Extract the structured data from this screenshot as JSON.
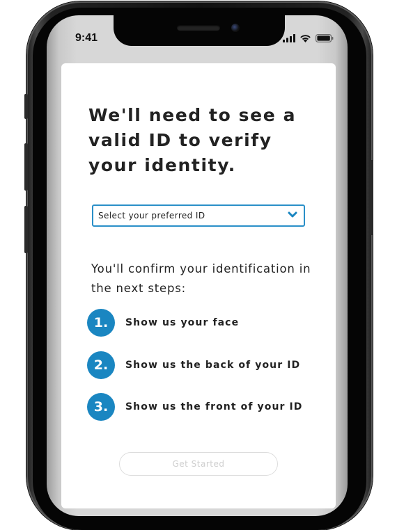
{
  "status_bar": {
    "time": "9:41",
    "icons": [
      "cellular-signal-icon",
      "wifi-icon",
      "battery-icon"
    ]
  },
  "card": {
    "title": "We'll need to see a valid ID to verify your identity.",
    "id_select": {
      "selected_text": "Select your preferred ID",
      "icon": "chevron-down-icon"
    },
    "intro": "You'll confirm your identification in the next steps:",
    "steps": [
      {
        "number": "1.",
        "label": "Show us your face"
      },
      {
        "number": "2.",
        "label": "Show us the back of your ID"
      },
      {
        "number": "3.",
        "label": "Show us the front of your ID"
      }
    ],
    "button_label": "Get Started"
  },
  "colors": {
    "accent": "#1a86c1",
    "select_border": "#2a8fc8",
    "text": "#222222",
    "disabled_button_text": "#cfcfcf"
  }
}
